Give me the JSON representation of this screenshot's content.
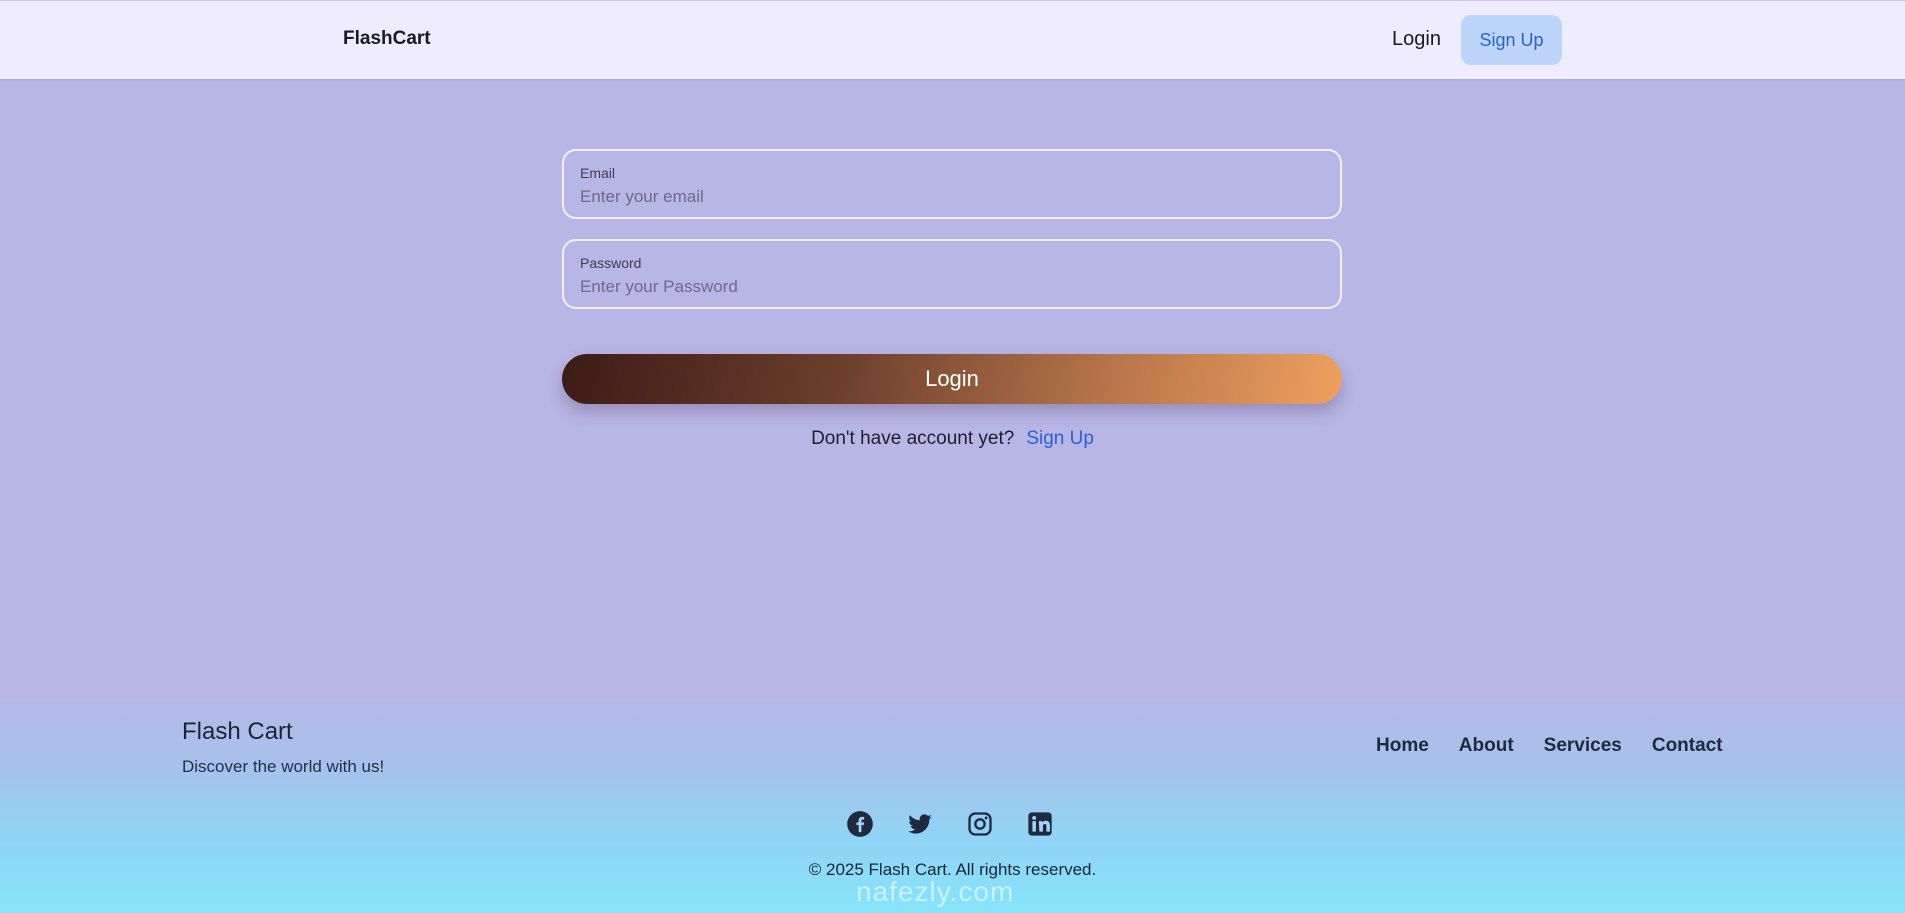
{
  "navbar": {
    "brand": "FlashCart",
    "login_label": "Login",
    "signup_label": "Sign Up"
  },
  "form": {
    "email": {
      "label": "Email",
      "placeholder": "Enter your email",
      "value": ""
    },
    "password": {
      "label": "Password",
      "placeholder": "Enter your Password",
      "value": ""
    },
    "submit_label": "Login",
    "signup_prompt": "Don't have account yet?",
    "signup_link": "Sign Up"
  },
  "footer": {
    "title": "Flash Cart",
    "tagline": "Discover the world with us!",
    "links": [
      "Home",
      "About",
      "Services",
      "Contact"
    ],
    "social_icons": [
      "facebook-icon",
      "twitter-icon",
      "instagram-icon",
      "linkedin-icon"
    ],
    "copyright": "© 2025 Flash Cart. All rights reserved."
  },
  "watermark": "nafezly.com",
  "colors": {
    "page_background": "#b8b6e4",
    "navbar_background": "#eeecfd",
    "signup_button_bg": "#bdd4fb",
    "link_blue": "#2f5fd6",
    "login_gradient_start": "#3e1a17",
    "login_gradient_end": "#eea05e"
  }
}
